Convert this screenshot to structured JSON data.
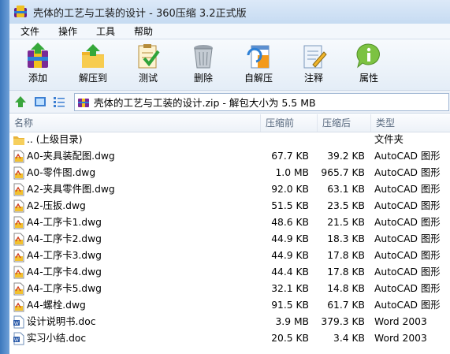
{
  "window": {
    "title": "壳体的工艺与工装的设计 - 360压缩 3.2正式版"
  },
  "menu": [
    "文件",
    "操作",
    "工具",
    "帮助"
  ],
  "toolbar": [
    {
      "label": "添加",
      "icon": "add-archive-icon"
    },
    {
      "label": "解压到",
      "icon": "extract-to-icon"
    },
    {
      "label": "测试",
      "icon": "test-checklist-icon"
    },
    {
      "label": "删除",
      "icon": "delete-trash-icon"
    },
    {
      "label": "自解压",
      "icon": "self-extract-icon"
    },
    {
      "label": "注释",
      "icon": "comment-notepad-icon"
    },
    {
      "label": "属性",
      "icon": "info-properties-icon"
    }
  ],
  "address": {
    "text": "壳体的工艺与工装的设计.zip - 解包大小为 5.5 MB"
  },
  "columns": {
    "name": "名称",
    "size": "压缩前",
    "compressed": "压缩后",
    "type": "类型"
  },
  "files": [
    {
      "name": ".. (上级目录)",
      "size": "",
      "compressed": "",
      "type": "文件夹",
      "icon": "folder"
    },
    {
      "name": "A0-夹具装配图.dwg",
      "size": "67.7 KB",
      "compressed": "39.2 KB",
      "type": "AutoCAD 图形",
      "icon": "dwg"
    },
    {
      "name": "A0-零件图.dwg",
      "size": "1.0 MB",
      "compressed": "965.7 KB",
      "type": "AutoCAD 图形",
      "icon": "dwg"
    },
    {
      "name": "A2-夹具零件图.dwg",
      "size": "92.0 KB",
      "compressed": "63.1 KB",
      "type": "AutoCAD 图形",
      "icon": "dwg"
    },
    {
      "name": "A2-压扳.dwg",
      "size": "51.5 KB",
      "compressed": "23.5 KB",
      "type": "AutoCAD 图形",
      "icon": "dwg"
    },
    {
      "name": "A4-工序卡1.dwg",
      "size": "48.6 KB",
      "compressed": "21.5 KB",
      "type": "AutoCAD 图形",
      "icon": "dwg"
    },
    {
      "name": "A4-工序卡2.dwg",
      "size": "44.9 KB",
      "compressed": "18.3 KB",
      "type": "AutoCAD 图形",
      "icon": "dwg"
    },
    {
      "name": "A4-工序卡3.dwg",
      "size": "44.9 KB",
      "compressed": "17.8 KB",
      "type": "AutoCAD 图形",
      "icon": "dwg"
    },
    {
      "name": "A4-工序卡4.dwg",
      "size": "44.4 KB",
      "compressed": "17.8 KB",
      "type": "AutoCAD 图形",
      "icon": "dwg"
    },
    {
      "name": "A4-工序卡5.dwg",
      "size": "32.1 KB",
      "compressed": "14.8 KB",
      "type": "AutoCAD 图形",
      "icon": "dwg"
    },
    {
      "name": "A4-螺栓.dwg",
      "size": "91.5 KB",
      "compressed": "61.7 KB",
      "type": "AutoCAD 图形",
      "icon": "dwg"
    },
    {
      "name": "设计说明书.doc",
      "size": "3.9 MB",
      "compressed": "379.3 KB",
      "type": "Word 2003",
      "icon": "doc"
    },
    {
      "name": "实习小结.doc",
      "size": "20.5 KB",
      "compressed": "3.4 KB",
      "type": "Word 2003",
      "icon": "doc"
    }
  ]
}
